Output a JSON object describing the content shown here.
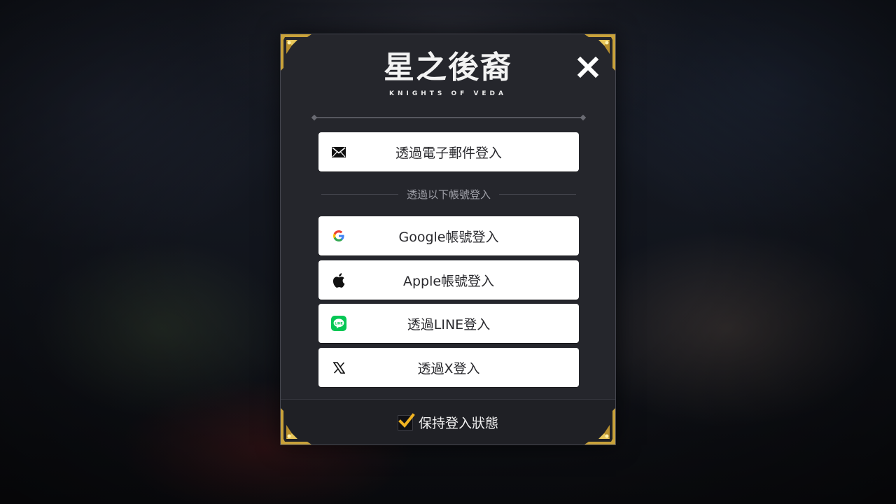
{
  "game": {
    "logo_title": "星之後裔",
    "logo_subtitle": "KNIGHTS OF VEDA"
  },
  "login": {
    "email_label": "透過電子郵件登入",
    "separator_label": "透過以下帳號登入",
    "google_label": "Google帳號登入",
    "apple_label": "Apple帳號登入",
    "line_label": "透過LINE登入",
    "x_label": "透過X登入"
  },
  "keep_signed_in": {
    "label": "保持登入狀態",
    "checked": true
  },
  "icons": [
    "close-icon",
    "mail-icon",
    "google-icon",
    "apple-icon",
    "line-icon",
    "x-icon",
    "checkmark-icon"
  ],
  "colors": {
    "panel_bg": "#25262c",
    "button_bg": "#ffffff",
    "gold_accent": "#e8b82a",
    "line_green": "#06c755"
  }
}
